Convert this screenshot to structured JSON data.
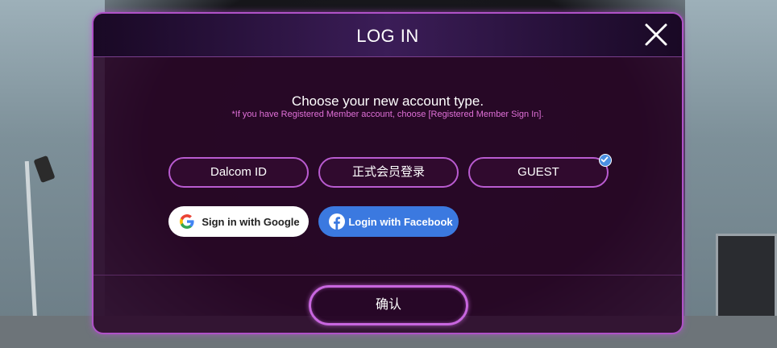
{
  "dialog": {
    "title": "LOG IN",
    "prompt": "Choose your new account type.",
    "note": "*If you have Registered Member account, choose [Registered Member Sign In].",
    "account_types": [
      {
        "label": "Dalcom ID",
        "selected": false
      },
      {
        "label": "正式会员登录",
        "selected": false
      },
      {
        "label": "GUEST",
        "selected": true
      }
    ],
    "google_label": "Sign in with Google",
    "facebook_label": "Login with Facebook",
    "confirm_label": "确认"
  },
  "icons": {
    "close": "close-icon",
    "check": "check-icon",
    "google": "google-icon",
    "facebook": "facebook-icon"
  },
  "colors": {
    "accent_border": "#b95bd0",
    "note_text": "#e070d8",
    "facebook_blue": "#3b79e0",
    "check_blue": "#4a90e2"
  }
}
